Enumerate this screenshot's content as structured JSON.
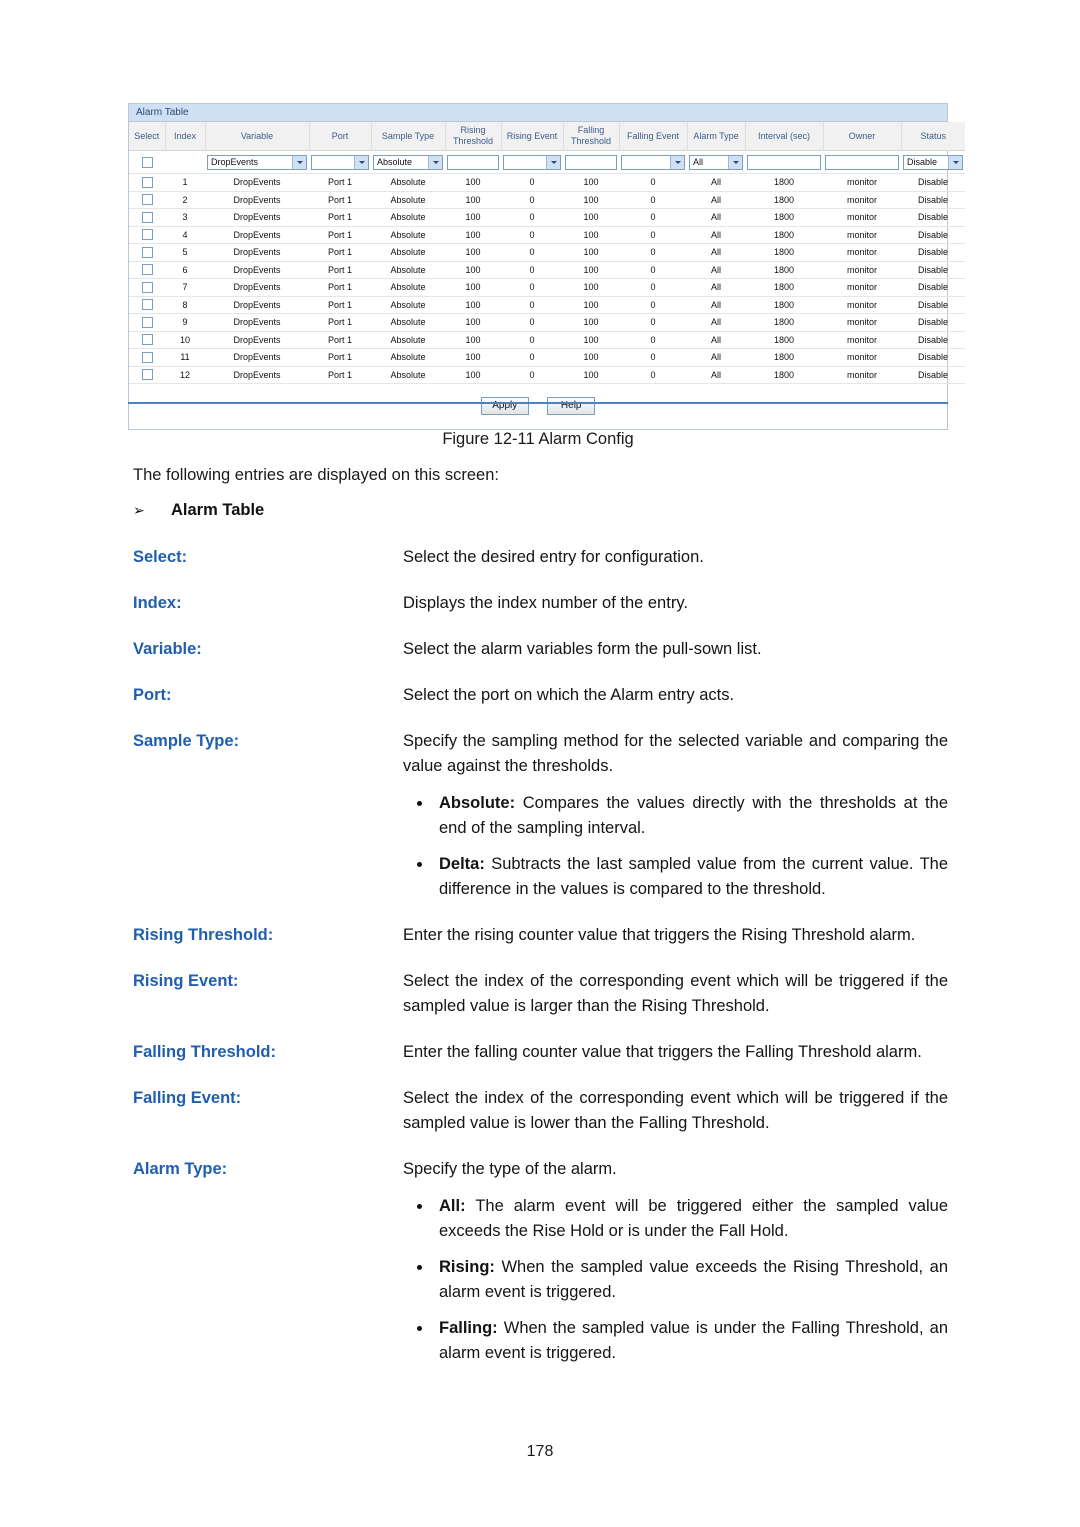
{
  "screenshot": {
    "panel_title": "Alarm Table",
    "columns": [
      "Select",
      "Index",
      "Variable",
      "Port",
      "Sample Type",
      "Rising Threshold",
      "Rising Event",
      "Falling Threshold",
      "Falling Event",
      "Alarm Type",
      "Interval (sec)",
      "Owner",
      "Status"
    ],
    "form_row": {
      "variable": "DropEvents",
      "port": "",
      "sample_type": "Absolute",
      "rising_threshold": "",
      "rising_event": "",
      "falling_threshold": "",
      "falling_event": "",
      "alarm_type": "All",
      "interval": "",
      "owner": "",
      "status": "Disable"
    },
    "rows": [
      {
        "index": "1",
        "variable": "DropEvents",
        "port": "Port 1",
        "sample_type": "Absolute",
        "rising_threshold": "100",
        "rising_event": "0",
        "falling_threshold": "100",
        "falling_event": "0",
        "alarm_type": "All",
        "interval": "1800",
        "owner": "monitor",
        "status": "Disable"
      },
      {
        "index": "2",
        "variable": "DropEvents",
        "port": "Port 1",
        "sample_type": "Absolute",
        "rising_threshold": "100",
        "rising_event": "0",
        "falling_threshold": "100",
        "falling_event": "0",
        "alarm_type": "All",
        "interval": "1800",
        "owner": "monitor",
        "status": "Disable"
      },
      {
        "index": "3",
        "variable": "DropEvents",
        "port": "Port 1",
        "sample_type": "Absolute",
        "rising_threshold": "100",
        "rising_event": "0",
        "falling_threshold": "100",
        "falling_event": "0",
        "alarm_type": "All",
        "interval": "1800",
        "owner": "monitor",
        "status": "Disable"
      },
      {
        "index": "4",
        "variable": "DropEvents",
        "port": "Port 1",
        "sample_type": "Absolute",
        "rising_threshold": "100",
        "rising_event": "0",
        "falling_threshold": "100",
        "falling_event": "0",
        "alarm_type": "All",
        "interval": "1800",
        "owner": "monitor",
        "status": "Disable"
      },
      {
        "index": "5",
        "variable": "DropEvents",
        "port": "Port 1",
        "sample_type": "Absolute",
        "rising_threshold": "100",
        "rising_event": "0",
        "falling_threshold": "100",
        "falling_event": "0",
        "alarm_type": "All",
        "interval": "1800",
        "owner": "monitor",
        "status": "Disable"
      },
      {
        "index": "6",
        "variable": "DropEvents",
        "port": "Port 1",
        "sample_type": "Absolute",
        "rising_threshold": "100",
        "rising_event": "0",
        "falling_threshold": "100",
        "falling_event": "0",
        "alarm_type": "All",
        "interval": "1800",
        "owner": "monitor",
        "status": "Disable"
      },
      {
        "index": "7",
        "variable": "DropEvents",
        "port": "Port 1",
        "sample_type": "Absolute",
        "rising_threshold": "100",
        "rising_event": "0",
        "falling_threshold": "100",
        "falling_event": "0",
        "alarm_type": "All",
        "interval": "1800",
        "owner": "monitor",
        "status": "Disable"
      },
      {
        "index": "8",
        "variable": "DropEvents",
        "port": "Port 1",
        "sample_type": "Absolute",
        "rising_threshold": "100",
        "rising_event": "0",
        "falling_threshold": "100",
        "falling_event": "0",
        "alarm_type": "All",
        "interval": "1800",
        "owner": "monitor",
        "status": "Disable"
      },
      {
        "index": "9",
        "variable": "DropEvents",
        "port": "Port 1",
        "sample_type": "Absolute",
        "rising_threshold": "100",
        "rising_event": "0",
        "falling_threshold": "100",
        "falling_event": "0",
        "alarm_type": "All",
        "interval": "1800",
        "owner": "monitor",
        "status": "Disable"
      },
      {
        "index": "10",
        "variable": "DropEvents",
        "port": "Port 1",
        "sample_type": "Absolute",
        "rising_threshold": "100",
        "rising_event": "0",
        "falling_threshold": "100",
        "falling_event": "0",
        "alarm_type": "All",
        "interval": "1800",
        "owner": "monitor",
        "status": "Disable"
      },
      {
        "index": "11",
        "variable": "DropEvents",
        "port": "Port 1",
        "sample_type": "Absolute",
        "rising_threshold": "100",
        "rising_event": "0",
        "falling_threshold": "100",
        "falling_event": "0",
        "alarm_type": "All",
        "interval": "1800",
        "owner": "monitor",
        "status": "Disable"
      },
      {
        "index": "12",
        "variable": "DropEvents",
        "port": "Port 1",
        "sample_type": "Absolute",
        "rising_threshold": "100",
        "rising_event": "0",
        "falling_threshold": "100",
        "falling_event": "0",
        "alarm_type": "All",
        "interval": "1800",
        "owner": "monitor",
        "status": "Disable"
      }
    ],
    "buttons": {
      "apply": "Apply",
      "help": "Help"
    }
  },
  "document": {
    "figure_caption": "Figure 12-11 Alarm Config",
    "intro": "The following entries are displayed on this screen:",
    "section_heading": "Alarm Table",
    "section_bullet_glyph": "➢",
    "definitions": [
      {
        "term": "Select:",
        "body": "Select the desired entry for configuration.",
        "bullets": []
      },
      {
        "term": "Index:",
        "body": "Displays the index number of the entry.",
        "bullets": []
      },
      {
        "term": "Variable:",
        "body": "Select the alarm variables form the pull-sown list.",
        "bullets": []
      },
      {
        "term": "Port:",
        "body": "Select the port on which the Alarm entry acts.",
        "bullets": []
      },
      {
        "term": "Sample Type:",
        "body": "Specify the sampling method for the selected variable and comparing the value against the thresholds.",
        "bullets": [
          {
            "label": "Absolute:",
            "text": " Compares the values directly with the thresholds at the end of the sampling interval."
          },
          {
            "label": "Delta:",
            "text": " Subtracts the last sampled value from the current value. The difference in the values is compared to the threshold."
          }
        ]
      },
      {
        "term": "Rising Threshold:",
        "body": "Enter the rising counter value that triggers the Rising Threshold alarm.",
        "bullets": []
      },
      {
        "term": "Rising Event:",
        "body": "Select the index of the corresponding event which will be triggered if the sampled value is larger than the Rising Threshold.",
        "bullets": []
      },
      {
        "term": "Falling Threshold:",
        "body": "Enter the falling counter value that triggers the Falling Threshold alarm.",
        "bullets": []
      },
      {
        "term": "Falling Event:",
        "body": "Select the index of the corresponding event which will be triggered if the sampled value is lower than the Falling Threshold.",
        "bullets": []
      },
      {
        "term": "Alarm Type:",
        "body": "Specify the type of the alarm.",
        "bullets": [
          {
            "label": "All:",
            "text": " The alarm event will be triggered either the sampled value exceeds the Rise Hold or is under the Fall Hold."
          },
          {
            "label": "Rising:",
            "text": " When the sampled value exceeds the Rising Threshold, an alarm event is triggered."
          },
          {
            "label": "Falling:",
            "text": " When the sampled value is under the Falling Threshold, an alarm event is triggered."
          }
        ]
      }
    ],
    "page_number": "178"
  }
}
